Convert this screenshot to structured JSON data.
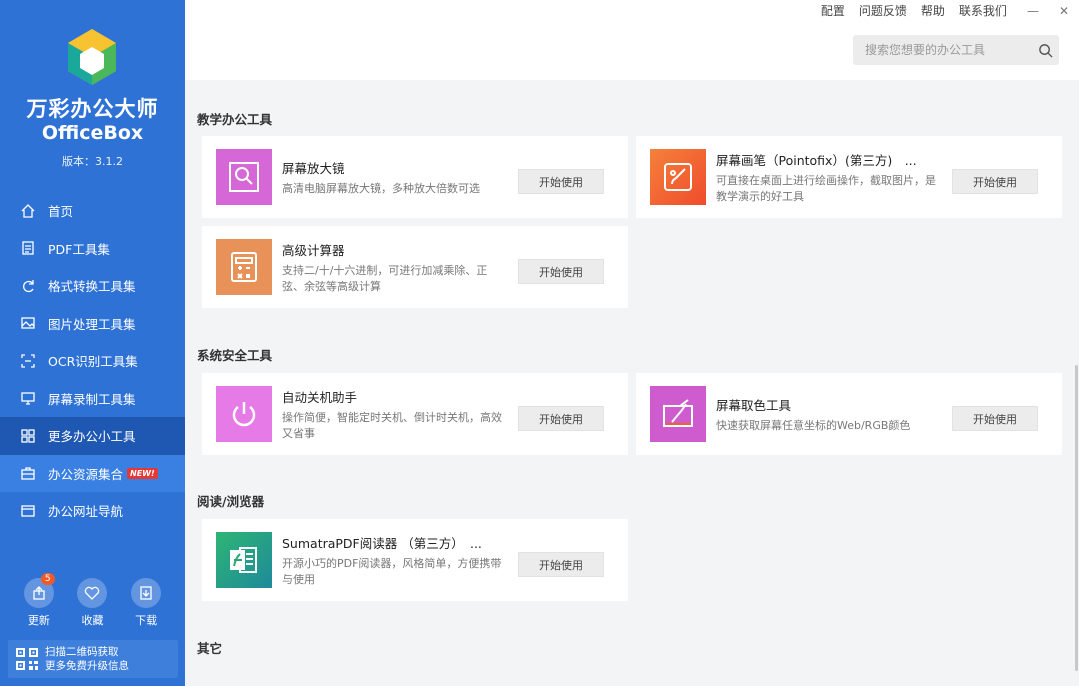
{
  "app": {
    "name": "万彩办公大师",
    "name_en": "OfficeBox",
    "version": "版本：3.1.2"
  },
  "top_links": {
    "settings": "配置",
    "feedback": "问题反馈",
    "help": "帮助",
    "contact": "联系我们",
    "minimize": "—",
    "close": "✕"
  },
  "search": {
    "placeholder": "搜索您想要的办公工具"
  },
  "sidebar": {
    "items": [
      {
        "label": "首页",
        "icon": "home-icon"
      },
      {
        "label": "PDF工具集",
        "icon": "pdf-icon"
      },
      {
        "label": "格式转换工具集",
        "icon": "convert-icon"
      },
      {
        "label": "图片处理工具集",
        "icon": "image-icon"
      },
      {
        "label": "OCR识别工具集",
        "icon": "ocr-icon"
      },
      {
        "label": "屏幕录制工具集",
        "icon": "monitor-icon"
      },
      {
        "label": "更多办公小工具",
        "icon": "grid-icon"
      },
      {
        "label": "办公资源集合",
        "icon": "briefcase-icon",
        "badge": "NEW!"
      },
      {
        "label": "办公网址导航",
        "icon": "browser-icon"
      }
    ],
    "active_index": 6,
    "hover_index": 7
  },
  "bottom": {
    "update": "更新",
    "update_count": "5",
    "favorite": "收藏",
    "download": "下载"
  },
  "qr": {
    "line1": "扫描二维码获取",
    "line2": "更多免费升级信息"
  },
  "sections": {
    "teaching": "教学办公工具",
    "security": "系统安全工具",
    "reader": "阅读/浏览器",
    "other": "其它"
  },
  "cards": {
    "magnifier": {
      "title": "屏幕放大镜",
      "desc": "高清电脑屏幕放大镜，多种放大倍数可选",
      "btn": "开始使用",
      "color": "#d667d6"
    },
    "pointofix": {
      "title": "屏幕画笔（Pointofix）(第三方)　...",
      "desc": "可直接在桌面上进行绘画操作，截取图片，是教学演示的好工具",
      "btn": "开始使用",
      "color": "#f06030"
    },
    "calculator": {
      "title": "高级计算器",
      "desc": "支持二/十/十六进制，可进行加减乘除、正弦、余弦等高级计算",
      "btn": "开始使用",
      "color": "#e8925a"
    },
    "shutdown": {
      "title": "自动关机助手",
      "desc": "操作简便，智能定时关机、倒计时关机，高效又省事",
      "btn": "开始使用",
      "color": "#e67ae6"
    },
    "colorpicker": {
      "title": "屏幕取色工具",
      "desc": "快速获取屏幕任意坐标的Web/RGB颜色",
      "btn": "开始使用",
      "color": "#cf5ccf"
    },
    "sumatra": {
      "title": "SumatraPDF阅读器 （第三方）　...",
      "desc": "开源小巧的PDF阅读器，风格简单，方便携带与使用",
      "btn": "开始使用",
      "color": "#2aa672"
    }
  }
}
